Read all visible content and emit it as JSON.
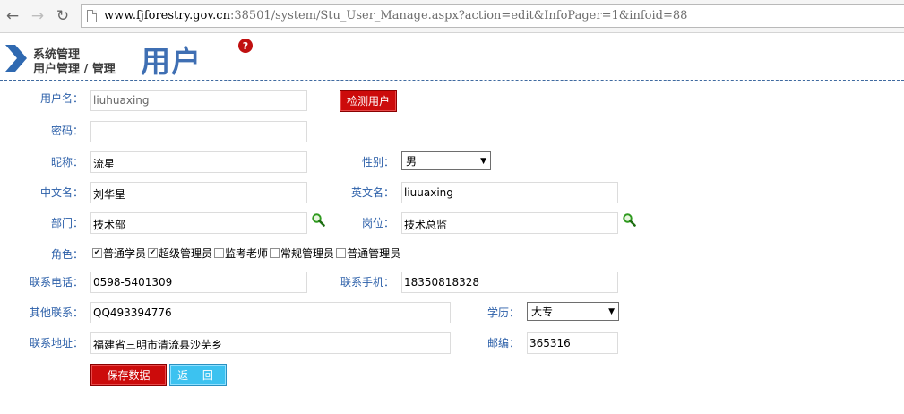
{
  "browser": {
    "url_host": "www.fjforestry.gov.cn",
    "url_rest": ":38501/system/Stu_User_Manage.aspx?action=edit&InfoPager=1&infoid=88"
  },
  "header": {
    "system_title": "系统管理",
    "breadcrumb": "用户管理 / 管理",
    "page_title": "用户",
    "help_glyph": "?"
  },
  "form": {
    "username": {
      "label": "用户名：",
      "value": "liuhuaxing"
    },
    "check_user_button": "检测用户",
    "password": {
      "label": "密码：",
      "value": ""
    },
    "nickname": {
      "label": "昵称：",
      "value": "流星"
    },
    "gender": {
      "label": "性别：",
      "selected": "男"
    },
    "chinese_name": {
      "label": "中文名：",
      "value": "刘华星"
    },
    "english_name": {
      "label": "英文名：",
      "value": "liuuaxing"
    },
    "department": {
      "label": "部门：",
      "value": "技术部"
    },
    "position": {
      "label": "岗位：",
      "value": "技术总监"
    },
    "roles": {
      "label": "角色：",
      "items": [
        {
          "label": "普通学员",
          "checked": true
        },
        {
          "label": "超级管理员",
          "checked": true
        },
        {
          "label": "监考老师",
          "checked": false
        },
        {
          "label": "常规管理员",
          "checked": false
        },
        {
          "label": "普通管理员",
          "checked": false
        }
      ]
    },
    "phone": {
      "label": "联系电话：",
      "value": "0598-5401309"
    },
    "mobile": {
      "label": "联系手机：",
      "value": "18350818328"
    },
    "other_contact": {
      "label": "其他联系：",
      "value": "QQ493394776"
    },
    "education": {
      "label": "学历：",
      "selected": "大专"
    },
    "address": {
      "label": "联系地址：",
      "value": "福建省三明市清流县沙芜乡"
    },
    "postcode": {
      "label": "邮编：",
      "value": "365316"
    },
    "save_button": "保存数据",
    "back_button": "返 回"
  },
  "colors": {
    "label_blue": "#2a5ea8",
    "title_blue": "#3f6fb3",
    "button_red": "#cc0b0b",
    "button_cyan": "#3cc2f0"
  }
}
